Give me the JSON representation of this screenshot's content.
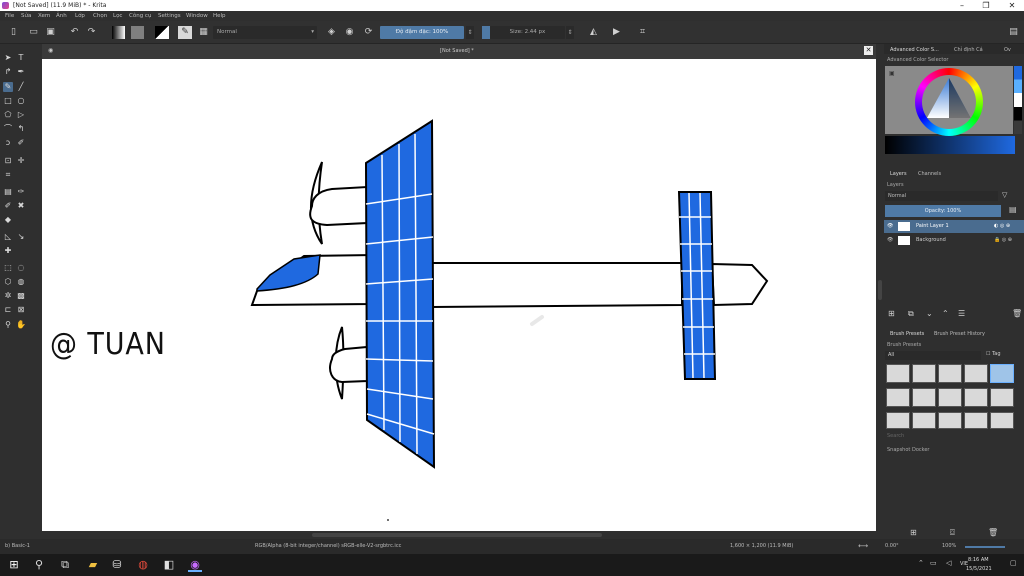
{
  "window": {
    "title": "[Not Saved]  (11.9 MiB)  * - Krita",
    "min": "–",
    "restore": "❐",
    "close": "✕"
  },
  "menu": [
    "File",
    "Sửa",
    "Xem",
    "Ảnh",
    "Lớp",
    "Chọn",
    "Lọc",
    "Công cụ",
    "Settings",
    "Window",
    "Help"
  ],
  "toolbar": {
    "blend_mode": "Normal",
    "opacity_label": "Độ đậm đặc: 100%",
    "size_label": "Size: 2.44 px"
  },
  "document": {
    "tab_title": "[Not Saved]  *",
    "watermark_text": "@ TUAN"
  },
  "dock": {
    "tabs": [
      "Advanced Color S...",
      "Chỉ định Cá",
      "Ov"
    ],
    "color_selector_title": "Advanced Color Selector",
    "layers_tabs": [
      "Layers",
      "Channels"
    ],
    "layers_title": "Layers",
    "layer_blend": "Normal",
    "layer_opacity": "Opacity: 100%",
    "layers": [
      {
        "name": "Paint Layer 1",
        "selected": true
      },
      {
        "name": "Background",
        "selected": false
      }
    ],
    "brush_tabs": [
      "Brush Presets",
      "Brush Preset History"
    ],
    "brush_title": "Brush Presets",
    "brush_filter": "All",
    "brush_tag": "Tag",
    "search_placeholder": "Search",
    "snapshot_title": "Snapshot Docker"
  },
  "status": {
    "tool": "b) Basic-1",
    "color_info": "RGB/Alpha (8-bit integer/channel)  sRGB-elle-V2-srgbtrc.icc",
    "dimensions": "1,600 × 1,200 (11.9 MiB)",
    "rotation": "0.00°",
    "zoom": "100%"
  },
  "taskbar": {
    "time": "8:16 AM",
    "date": "15/5/2021",
    "lang": "VIE"
  },
  "colors": {
    "accent": "#4a6c8f",
    "panel_blue": "#1f69e0",
    "canvas": "#ffffff"
  }
}
